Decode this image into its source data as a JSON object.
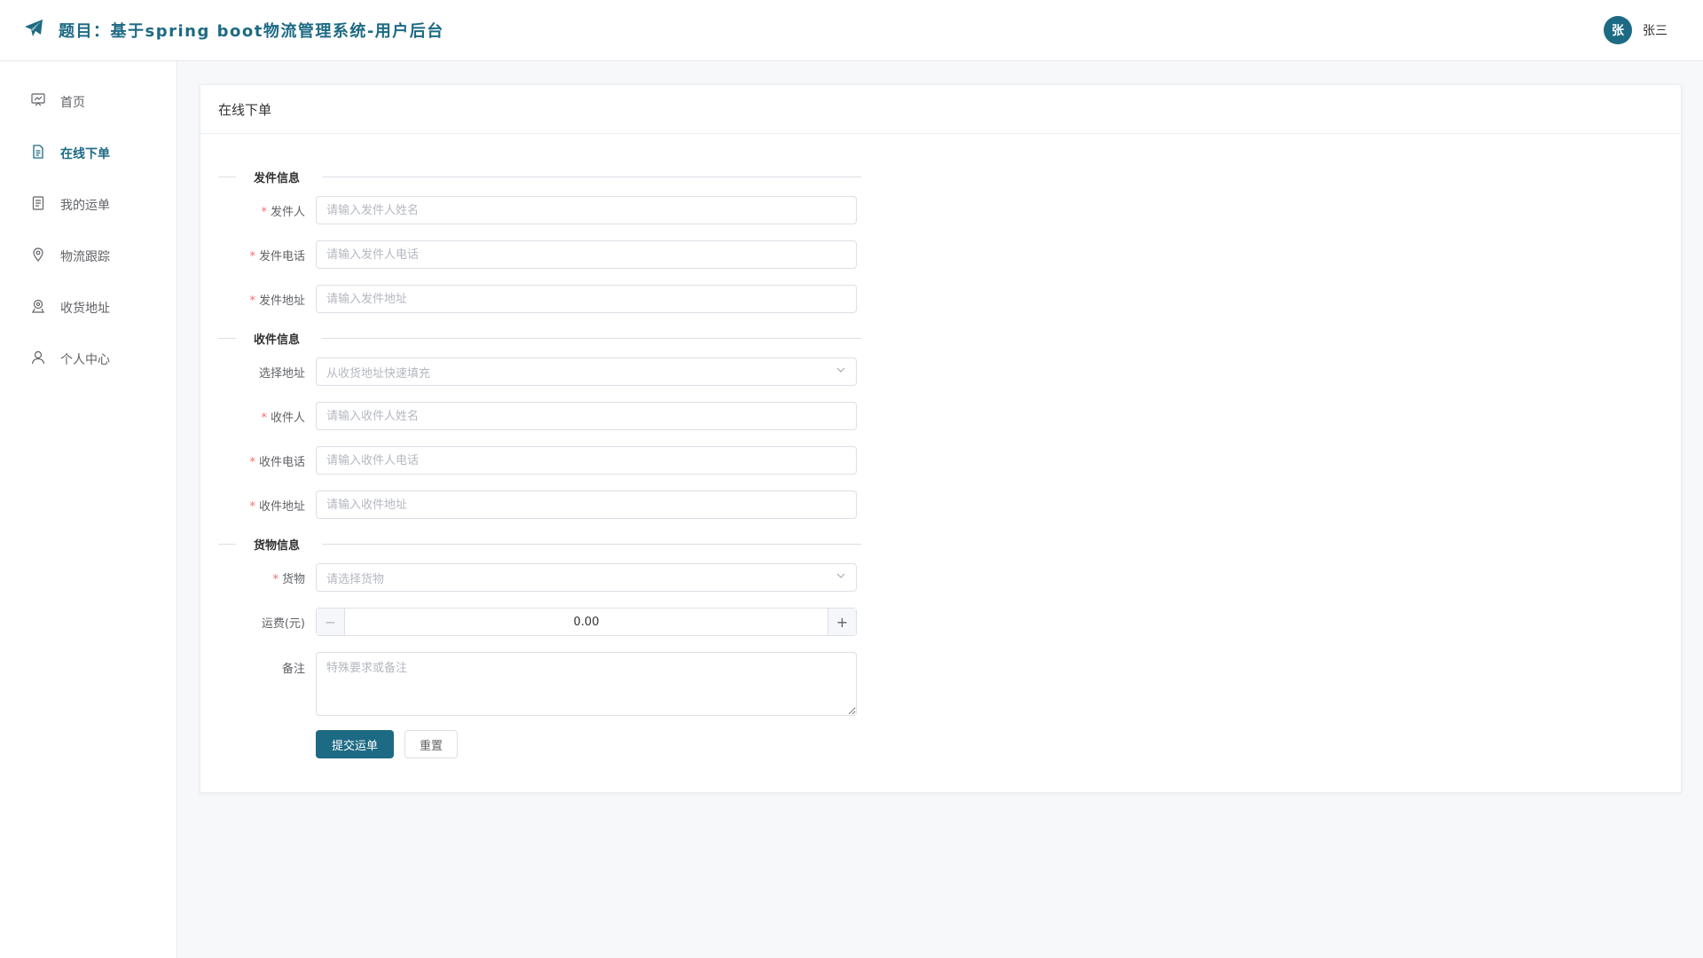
{
  "header": {
    "title": "题目：基于spring boot物流管理系统-用户后台",
    "logo_icon": "paper-plane-icon",
    "user": {
      "avatar_text": "张",
      "name": "张三"
    }
  },
  "sidebar": {
    "items": [
      {
        "label": "首页",
        "icon": "dashboard-icon",
        "active": false
      },
      {
        "label": "在线下单",
        "icon": "document-icon",
        "active": true
      },
      {
        "label": "我的运单",
        "icon": "list-icon",
        "active": false
      },
      {
        "label": "物流跟踪",
        "icon": "location-icon",
        "active": false
      },
      {
        "label": "收货地址",
        "icon": "address-icon",
        "active": false
      },
      {
        "label": "个人中心",
        "icon": "user-icon",
        "active": false
      }
    ]
  },
  "card": {
    "title": "在线下单",
    "sender_section": "发件信息",
    "sender": {
      "name_label": "发件人",
      "name_placeholder": "请输入发件人姓名",
      "phone_label": "发件电话",
      "phone_placeholder": "请输入发件人电话",
      "address_label": "发件地址",
      "address_placeholder": "请输入发件地址"
    },
    "receiver_section": "收件信息",
    "receiver": {
      "select_label": "选择地址",
      "select_placeholder": "从收货地址快速填充",
      "name_label": "收件人",
      "name_placeholder": "请输入收件人姓名",
      "phone_label": "收件电话",
      "phone_placeholder": "请输入收件人电话",
      "address_label": "收件地址",
      "address_placeholder": "请输入收件地址"
    },
    "goods_section": "货物信息",
    "goods": {
      "goods_label": "货物",
      "goods_placeholder": "请选择货物",
      "fee_label": "运费(元)",
      "fee_value": "0.00",
      "fee_minus": "−",
      "fee_plus": "+",
      "remark_label": "备注",
      "remark_placeholder": "特殊要求或备注"
    },
    "required_mark": "*",
    "submit_label": "提交运单",
    "reset_label": "重置"
  },
  "colors": {
    "accent": "#1d6a84",
    "required": "#f56c6c"
  }
}
